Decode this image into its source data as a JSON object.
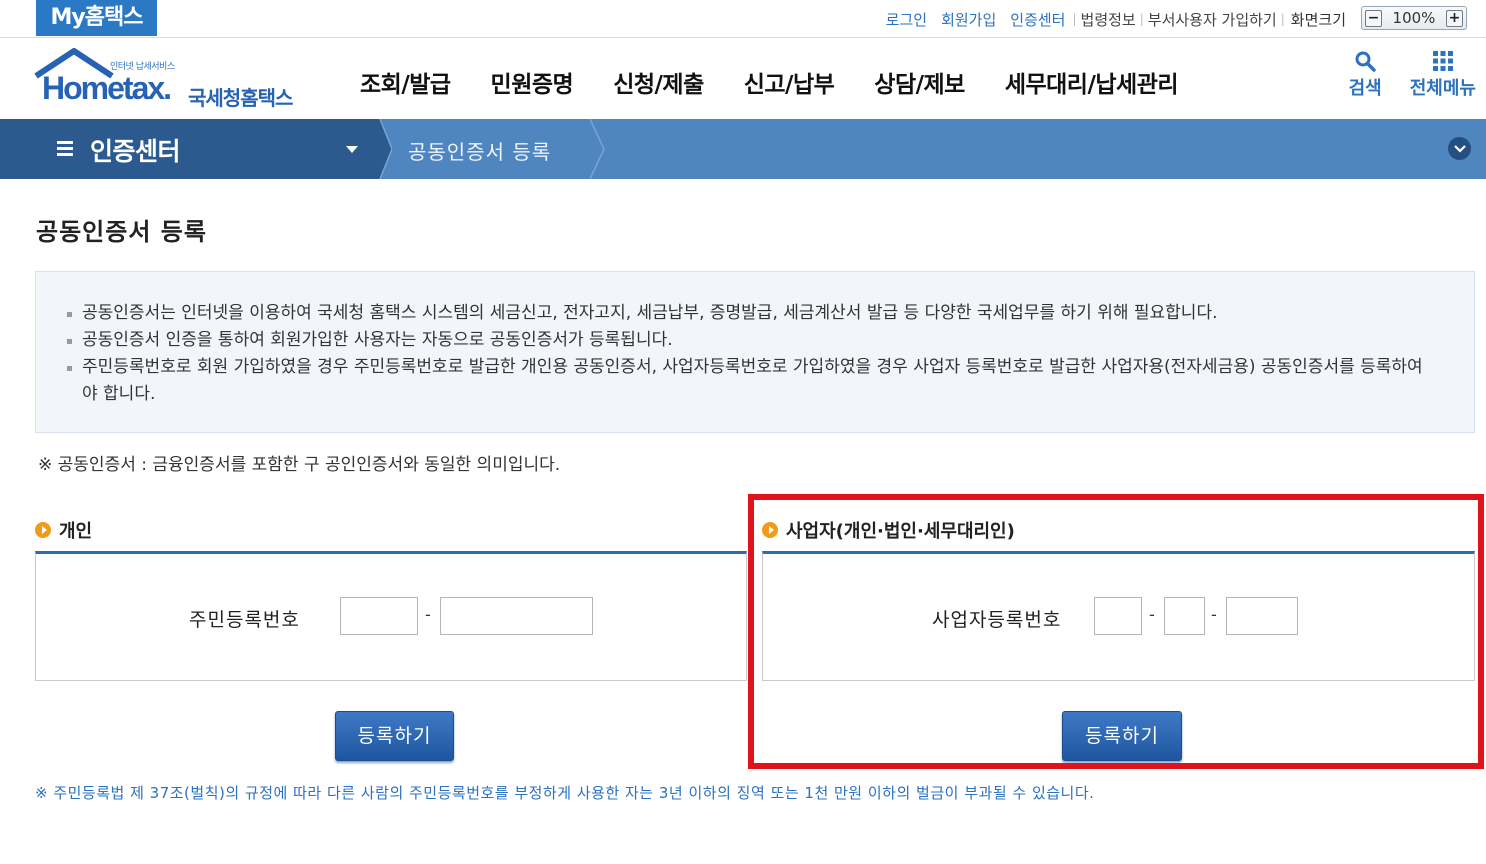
{
  "topbar": {
    "my_home": "My홈택스",
    "links": [
      "로그인",
      "회원가입",
      "인증센터"
    ],
    "gray_links": [
      "법령정보",
      "부서사용자 가입하기"
    ],
    "zoom_label": "화면크기",
    "zoom_value": "100%",
    "zoom_minus": "−",
    "zoom_plus": "+"
  },
  "header": {
    "logo_tiny": "인터넷 납세서비스",
    "logo_home": "Hometax.",
    "logo_kr": "국세청홈택스",
    "gnb": [
      "조회/발급",
      "민원증명",
      "신청/제출",
      "신고/납부",
      "상담/제보",
      "세무대리/납세관리"
    ],
    "tools": {
      "search": "검색",
      "all_menu": "전체메뉴"
    }
  },
  "location": {
    "section": "인증센터",
    "crumb": "공동인증서 등록"
  },
  "main": {
    "title": "공동인증서 등록",
    "info": [
      "공동인증서는 인터넷을 이용하여 국세청 홈택스 시스템의 세금신고, 전자고지, 세금납부, 증명발급, 세금계산서 발급 등 다양한 국세업무를 하기 위해 필요합니다.",
      "공동인증서 인증을 통하여 회원가입한 사용자는 자동으로 공동인증서가 등록됩니다.",
      "주민등록번호로 회원 가입하였을 경우 주민등록번호로 발급한 개인용 공동인증서, 사업자등록번호로 가입하였을 경우 사업자 등록번호로 발급한 사업자용(전자세금용) 공동인증서를 등록하여야 합니다."
    ],
    "notice": "※ 공동인증서 : 금융인증서를 포함한 구 공인인증서와 동일한 의미입니다.",
    "personal": {
      "title": "개인",
      "label": "주민등록번호",
      "button": "등록하기",
      "dash": "-"
    },
    "business": {
      "title": "사업자(개인·법인·세무대리인)",
      "label": "사업자등록번호",
      "button": "등록하기",
      "dash": "-"
    },
    "footnote": "※ 주민등록법 제 37조(벌칙)의 규정에 따라 다른 사람의 주민등록번호를 부정하게 사용한 자는 3년 이하의 징역 또는 1천 만원 이하의 벌금이 부과될 수 있습니다."
  },
  "colors": {
    "brand_blue": "#2b72c0",
    "nav_dark": "#2c5a8f",
    "nav_light": "#4f86c0",
    "highlight": "#e0131b",
    "bullet_orange": "#f29a19"
  }
}
